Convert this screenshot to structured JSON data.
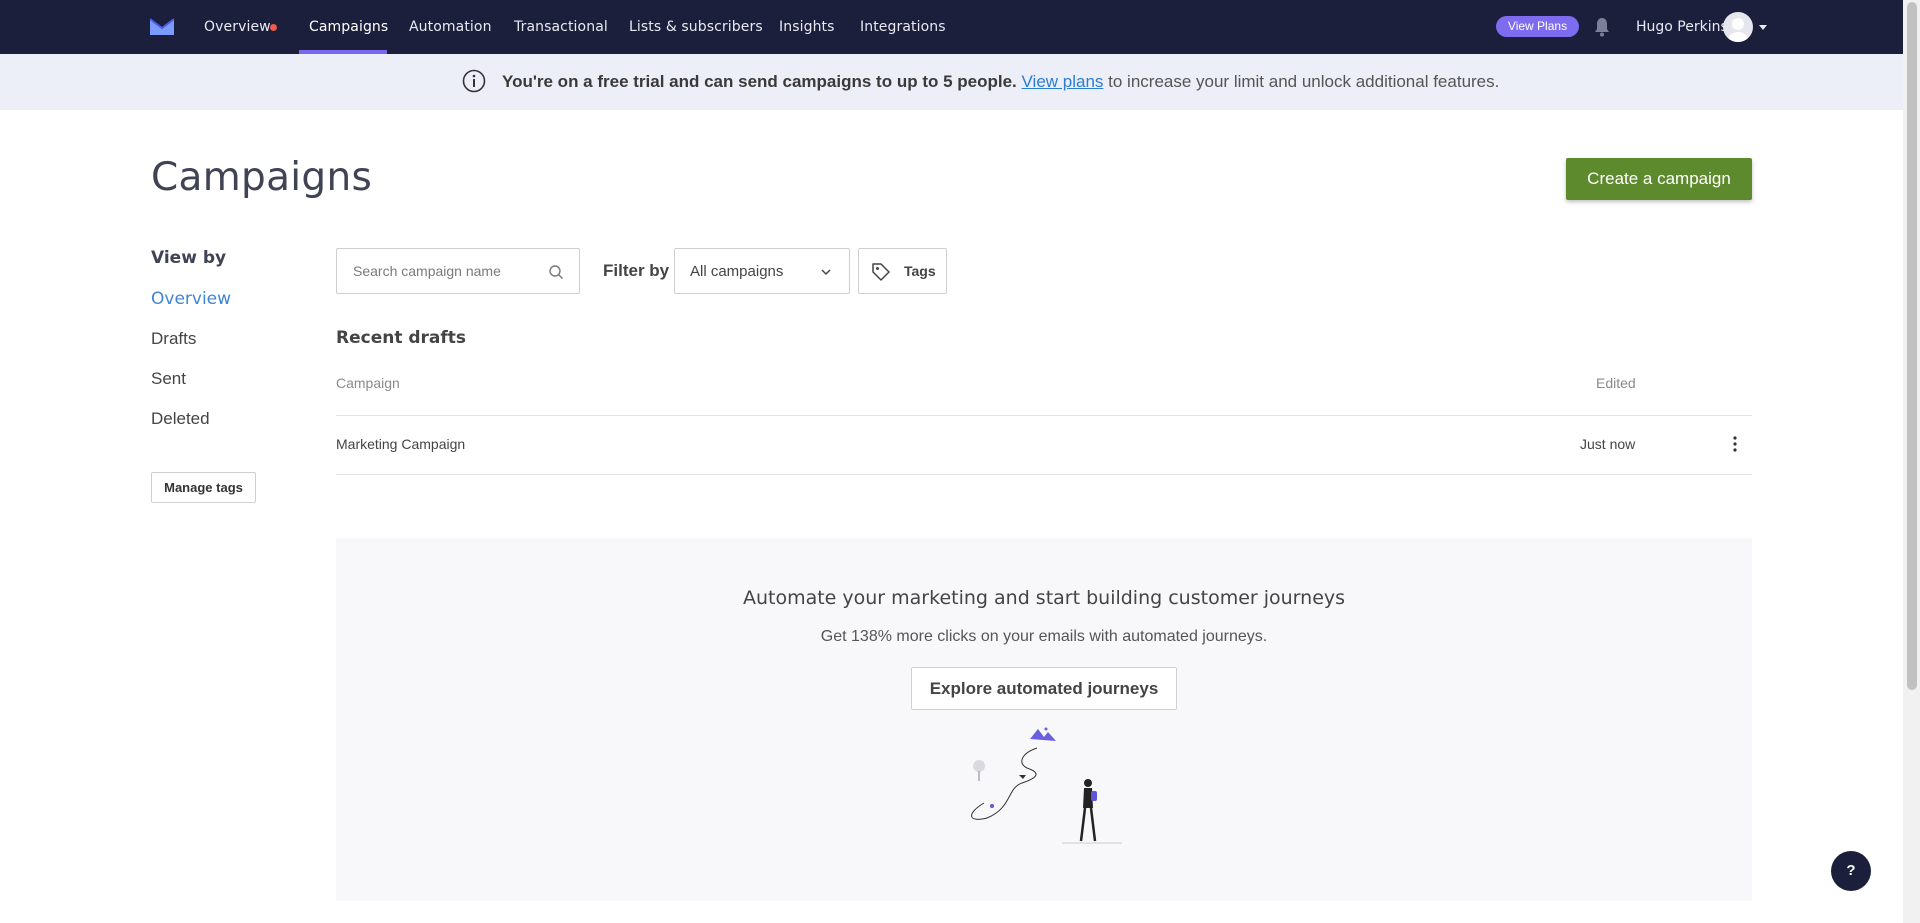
{
  "nav": {
    "items": [
      {
        "label": "Overview"
      },
      {
        "label": "Campaigns"
      },
      {
        "label": "Automation"
      },
      {
        "label": "Transactional"
      },
      {
        "label": "Lists & subscribers"
      },
      {
        "label": "Insights"
      },
      {
        "label": "Integrations"
      }
    ],
    "active_item": "Campaigns",
    "view_plans_label": "View Plans",
    "user_name": "Hugo Perkins",
    "colors": {
      "background": "#1b1f3b",
      "accent": "#7b68ee",
      "notification_dot": "#ee5c4c"
    }
  },
  "banner": {
    "bold_text": "You're on a free trial and can send campaigns to up to 5 people.",
    "link_text": "View plans",
    "rest_text": " to increase your limit and unlock additional features.",
    "icon": "info-icon"
  },
  "page": {
    "title": "Campaigns",
    "create_button": "Create a campaign",
    "create_button_color": "#5d8a2c"
  },
  "sidebar": {
    "heading": "View by",
    "items": [
      {
        "label": "Overview"
      },
      {
        "label": "Drafts"
      },
      {
        "label": "Sent"
      },
      {
        "label": "Deleted"
      }
    ],
    "active_item": "Overview",
    "manage_tags": "Manage tags"
  },
  "filters": {
    "search_placeholder": "Search campaign name",
    "filter_label": "Filter by",
    "filter_value": "All campaigns",
    "tags_label": "Tags"
  },
  "drafts": {
    "title": "Recent drafts",
    "columns": {
      "campaign": "Campaign",
      "edited": "Edited"
    },
    "rows": [
      {
        "campaign": "Marketing Campaign",
        "edited": "Just now"
      }
    ]
  },
  "promo": {
    "title": "Automate your marketing and start building customer journeys",
    "subtitle": "Get 138% more clicks on your emails with automated journeys.",
    "button": "Explore automated journeys"
  },
  "help_label": "?"
}
